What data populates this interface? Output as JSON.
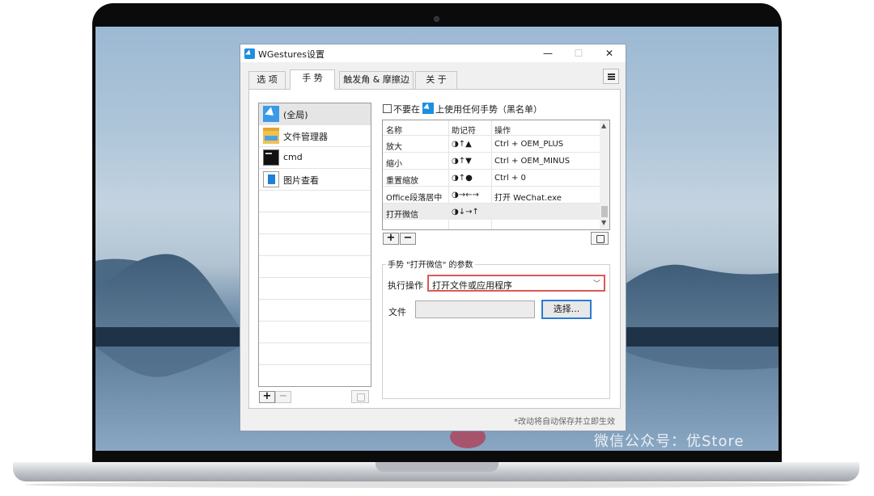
{
  "window": {
    "title": "WGestures设置",
    "min_glyph": "—",
    "max_glyph": "☐",
    "close_glyph": "✕"
  },
  "tabs": [
    {
      "label": "选 项",
      "active": false
    },
    {
      "label": "手 势",
      "active": true
    },
    {
      "label": "触发角 & 摩擦边",
      "active": false
    },
    {
      "label": "关 于",
      "active": false
    }
  ],
  "apps": [
    {
      "label": "(全局)",
      "icon": "cursor-icon",
      "selected": true
    },
    {
      "label": "文件管理器",
      "icon": "folder-icon",
      "selected": false
    },
    {
      "label": "cmd",
      "icon": "console-icon",
      "selected": false
    },
    {
      "label": "图片查看",
      "icon": "photo-viewer-icon",
      "selected": false
    }
  ],
  "app_buttons": {
    "add": "+",
    "remove": "−"
  },
  "blacklist": {
    "prefix": "不要在",
    "suffix": "上使用任何手势（黑名单）",
    "checked": false
  },
  "gestures": {
    "columns": [
      "名称",
      "助记符",
      "操作"
    ],
    "rows": [
      {
        "name": "放大",
        "mnemonic": "◑↑▲",
        "action": "Ctrl + OEM_PLUS"
      },
      {
        "name": "缩小",
        "mnemonic": "◑↑▼",
        "action": "Ctrl + OEM_MINUS"
      },
      {
        "name": "重置缩放",
        "mnemonic": "◑↑●",
        "action": "Ctrl + 0"
      },
      {
        "name": "Office段落居中",
        "mnemonic": "◑→←→",
        "action": "打开 WeChat.exe"
      },
      {
        "name": "打开微信",
        "mnemonic": "◑↓→↑",
        "action": ""
      }
    ],
    "add": "+",
    "remove": "−"
  },
  "params": {
    "legend": "手势 \"打开微信\" 的参数",
    "action_label": "执行操作",
    "action_value": "打开文件或应用程序",
    "file_label": "文件",
    "file_value": "",
    "choose_button": "选择..."
  },
  "footer_note": "*改动将自动保存并立即生效",
  "watermark": "微信公众号：优Store",
  "colors": {
    "accent": "#1d8fe0",
    "highlight_border": "#d9534f",
    "choose_border": "#2d7bd3"
  }
}
